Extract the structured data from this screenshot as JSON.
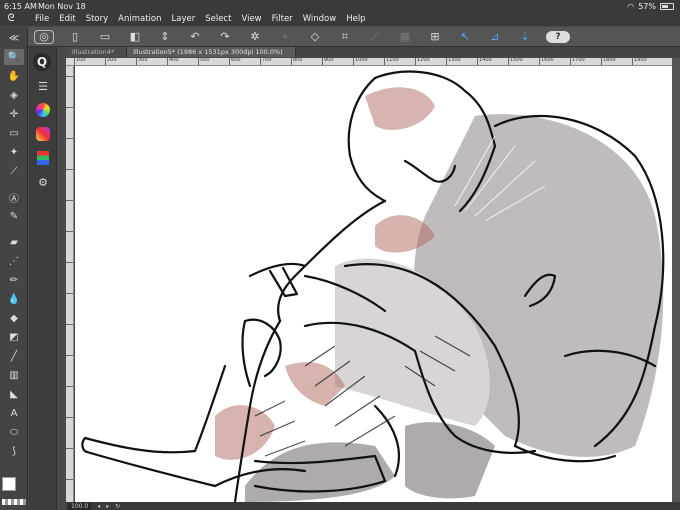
{
  "status": {
    "time": "6:15 AM",
    "date": "Mon Nov 18",
    "battery": "57%"
  },
  "menu": [
    "File",
    "Edit",
    "Story",
    "Animation",
    "Layer",
    "Select",
    "View",
    "Filter",
    "Window",
    "Help"
  ],
  "tabs": [
    {
      "label": "Illustration4*"
    },
    {
      "label": "Illustration5* (1986 x 1531px 300dpi 100.0%)"
    }
  ],
  "ruler": {
    "top_ticks": [
      "100",
      "200",
      "300",
      "400",
      "500",
      "600",
      "700",
      "800",
      "900",
      "1000",
      "1100",
      "1200",
      "1300",
      "1400",
      "1500",
      "1600",
      "1700",
      "1800",
      "1900"
    ]
  },
  "bottom": {
    "zoom": "100.0"
  },
  "colors": {
    "main": "#ffffff",
    "sub": "#111111",
    "accent_blue": "#4ea6ff"
  }
}
